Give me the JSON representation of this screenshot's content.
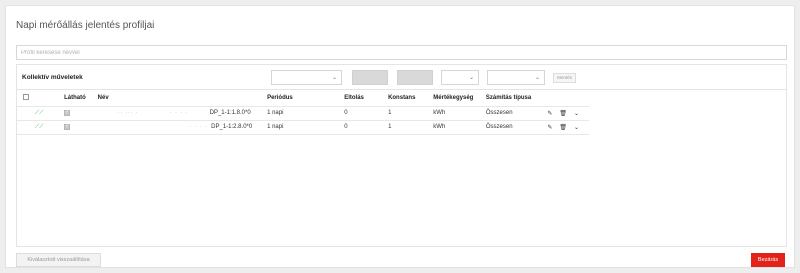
{
  "modal": {
    "title": "Napi mérőállás jelentés profiljai",
    "search_placeholder": "Profil keresése névvel"
  },
  "bulk": {
    "label": "Kollektív műveletek",
    "apply_label": "Mentés"
  },
  "table": {
    "headers": {
      "visible": "Látható",
      "name": "Név",
      "period": "Periódus",
      "offset": "Eltolás",
      "constant": "Konstans",
      "unit": "Mértékegység",
      "calc": "Számítás típusa"
    },
    "rows": [
      {
        "name_a": "·· ··· ·",
        "name_b": "· · · ·",
        "code": "DP_1-1:1.8.0*0",
        "period": "1 napi",
        "offset": "0",
        "constant": "1",
        "unit": "kWh",
        "calc": "Összesen"
      },
      {
        "name_a": "",
        "name_b": "· · · ·",
        "code": "DP_1-1:2.8.0*0",
        "period": "1 napi",
        "offset": "0",
        "constant": "1",
        "unit": "kWh",
        "calc": "Összesen"
      }
    ]
  },
  "footer": {
    "reset_label": "Kiválasztott visszaállítása",
    "close_label": "Bezárás"
  },
  "colors": {
    "accent_red": "#e2231a",
    "chart_green": "#3cb44b"
  },
  "icons": [
    "chart-line-icon",
    "pencil-icon",
    "trash-icon",
    "chevron-down-icon"
  ]
}
